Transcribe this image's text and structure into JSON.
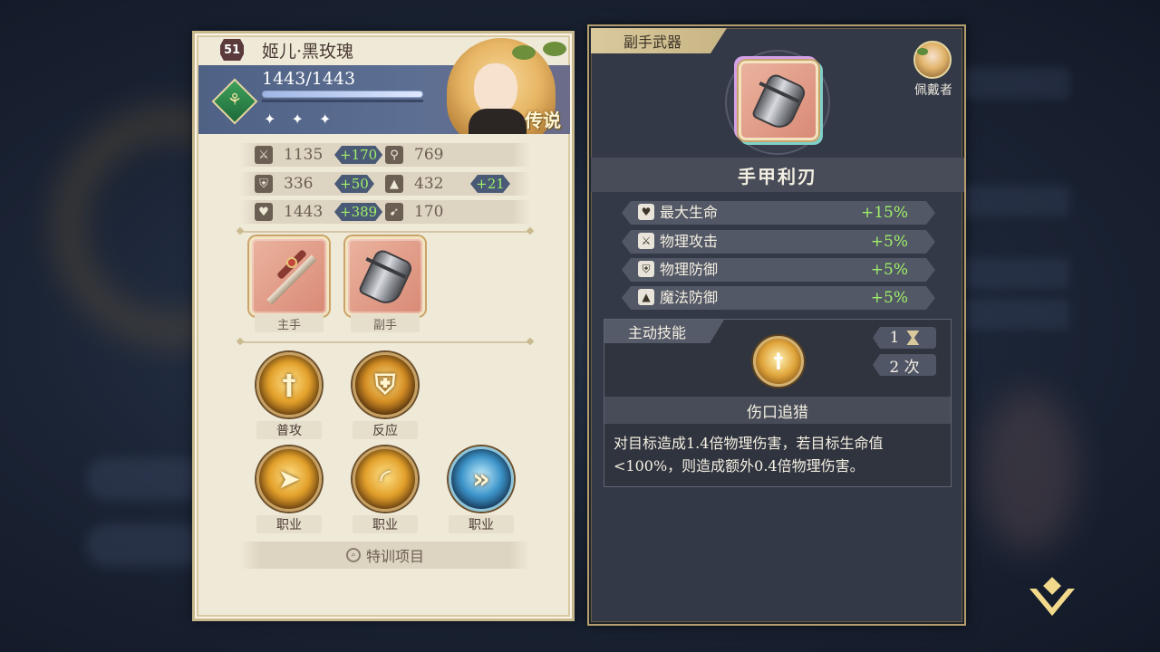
{
  "hero": {
    "level": "51",
    "name": "姬儿·黑玫瑰",
    "hp": "1443/1443",
    "hp_fraction": 1.0,
    "stars": "✦ ✦ ✦",
    "rarity": "传说"
  },
  "stats": [
    {
      "icon": "sword-icon",
      "glyph": "⚔",
      "value": "1135",
      "bonus": "+170"
    },
    {
      "icon": "staff-icon",
      "glyph": "⚲",
      "value": "769",
      "bonus": ""
    },
    {
      "icon": "shield-icon",
      "glyph": "⛨",
      "value": "336",
      "bonus": "+50"
    },
    {
      "icon": "wizard-hat-icon",
      "glyph": "▲",
      "value": "432",
      "bonus": "+21"
    },
    {
      "icon": "heart-icon",
      "glyph": "♥",
      "value": "1443",
      "bonus": "+389"
    },
    {
      "icon": "boot-icon",
      "glyph": "➹",
      "value": "170",
      "bonus": ""
    }
  ],
  "equipment": {
    "main_hand_label": "主手",
    "off_hand_label": "副手"
  },
  "skills": {
    "basic_label": "普攻",
    "reaction_label": "反应",
    "class1_label": "职业",
    "class2_label": "职业",
    "class3_label": "职业"
  },
  "training_button": "特训项目",
  "detail": {
    "tab_title": "副手武器",
    "wearer_label": "佩戴者",
    "item_name": "手甲利刃",
    "attributes": [
      {
        "icon": "heart-icon",
        "glyph": "♥",
        "name": "最大生命",
        "value": "+15%"
      },
      {
        "icon": "sword-icon",
        "glyph": "⚔",
        "name": "物理攻击",
        "value": "+5%"
      },
      {
        "icon": "shield-icon",
        "glyph": "⛨",
        "name": "物理防御",
        "value": "+5%"
      },
      {
        "icon": "wizard-hat-icon",
        "glyph": "▲",
        "name": "魔法防御",
        "value": "+5%"
      }
    ],
    "active_skill_tab": "主动技能",
    "cooldown": "1",
    "uses": "2 次",
    "skill_name": "伤口追猎",
    "skill_desc": "对目标造成1.4倍物理伤害，若目标生命值<100%，则造成额外0.4倍物理伤害。"
  },
  "colors": {
    "bonus_green": "#9ff06a",
    "panel_cream": "#efe9d8",
    "panel_dark": "#343947",
    "gold_border": "#c9b98f"
  }
}
